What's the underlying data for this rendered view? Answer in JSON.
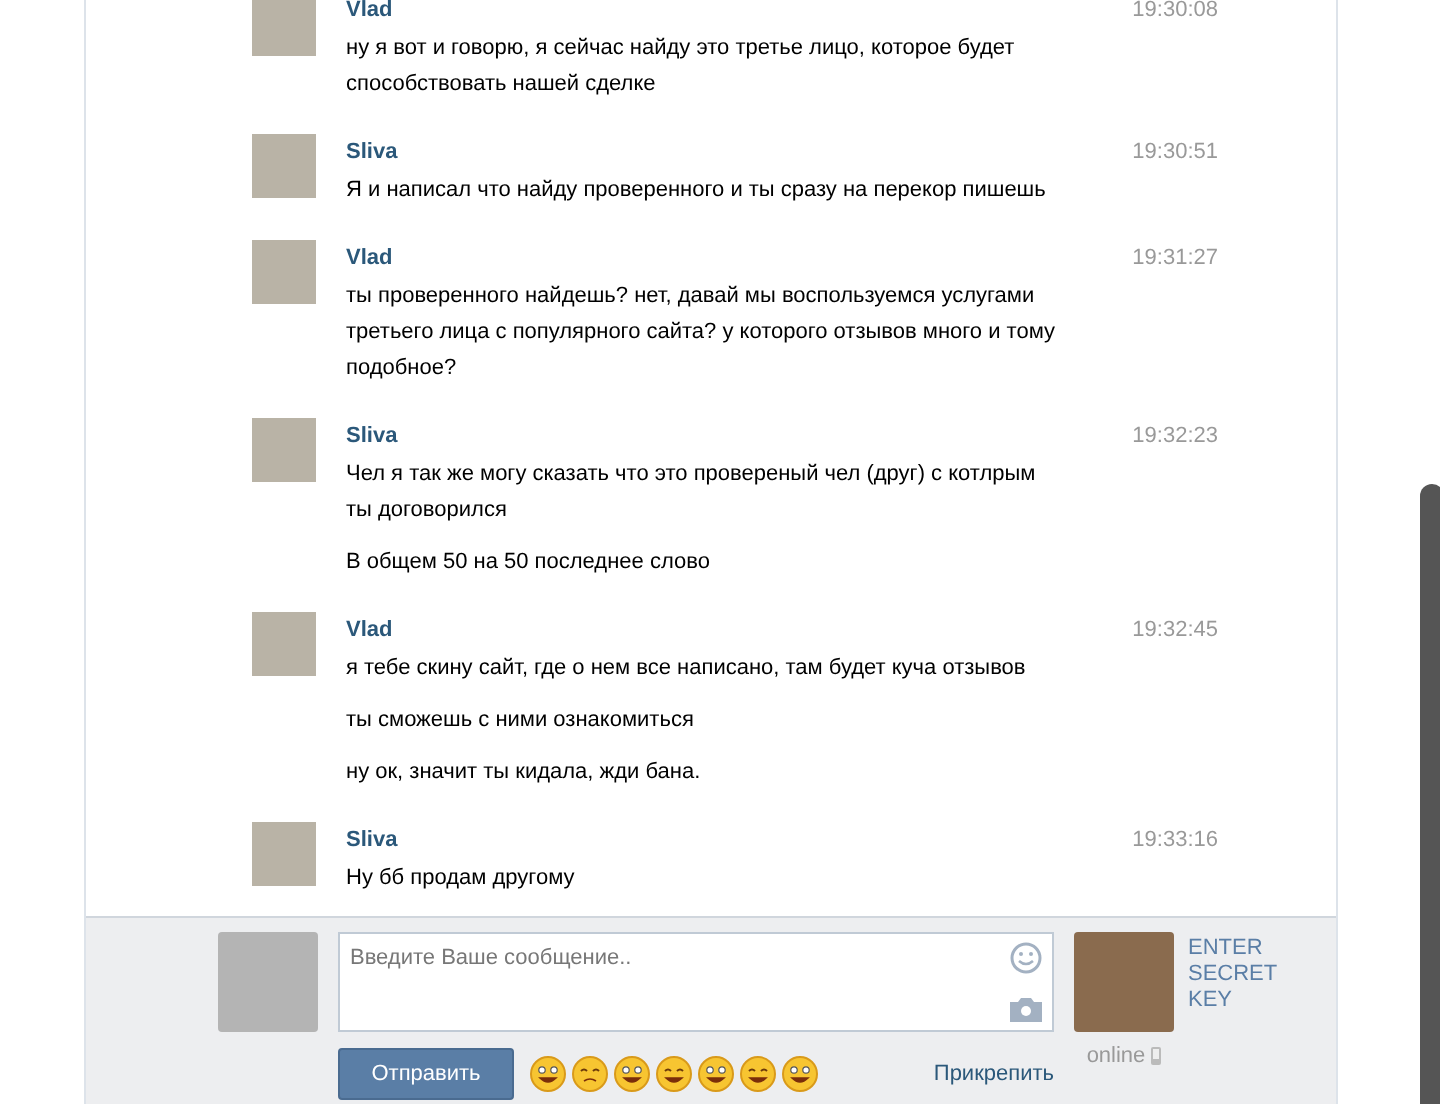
{
  "messages": [
    {
      "author": "Vlad",
      "time": "19:30:08",
      "texts": [
        "ну я вот и говорю, я сейчас найду это третье лицо, которое будет способствовать нашей сделке"
      ]
    },
    {
      "author": "Sliva",
      "time": "19:30:51",
      "texts": [
        "Я и написал что найду проверенного и ты сразу на перекор пишешь"
      ]
    },
    {
      "author": "Vlad",
      "time": "19:31:27",
      "texts": [
        "ты проверенного найдешь? нет, давай мы воспользуемся услугами третьего лица с популярного сайта? у которого отзывов много и тому подобное?"
      ]
    },
    {
      "author": "Sliva",
      "time": "19:32:23",
      "texts": [
        "Чел я так же могу сказать что это провереный чел (друг) с котлрым ты договорился",
        "В общем 50 на 50 последнее слово"
      ]
    },
    {
      "author": "Vlad",
      "time": "19:32:45",
      "texts": [
        "я тебе скину сайт, где о нем все написано, там будет куча отзывов",
        "ты сможешь с ними ознакомиться",
        "ну ок, значит ты кидала, жди бана."
      ]
    },
    {
      "author": "Sliva",
      "time": "19:33:16",
      "texts": [
        "Ну бб продам другому"
      ]
    }
  ],
  "composer": {
    "placeholder": "Введите Ваше сообщение..",
    "send": "Отправить",
    "attach": "Прикрепить",
    "secret": "ENTER SECRET KEY",
    "status": "online"
  }
}
